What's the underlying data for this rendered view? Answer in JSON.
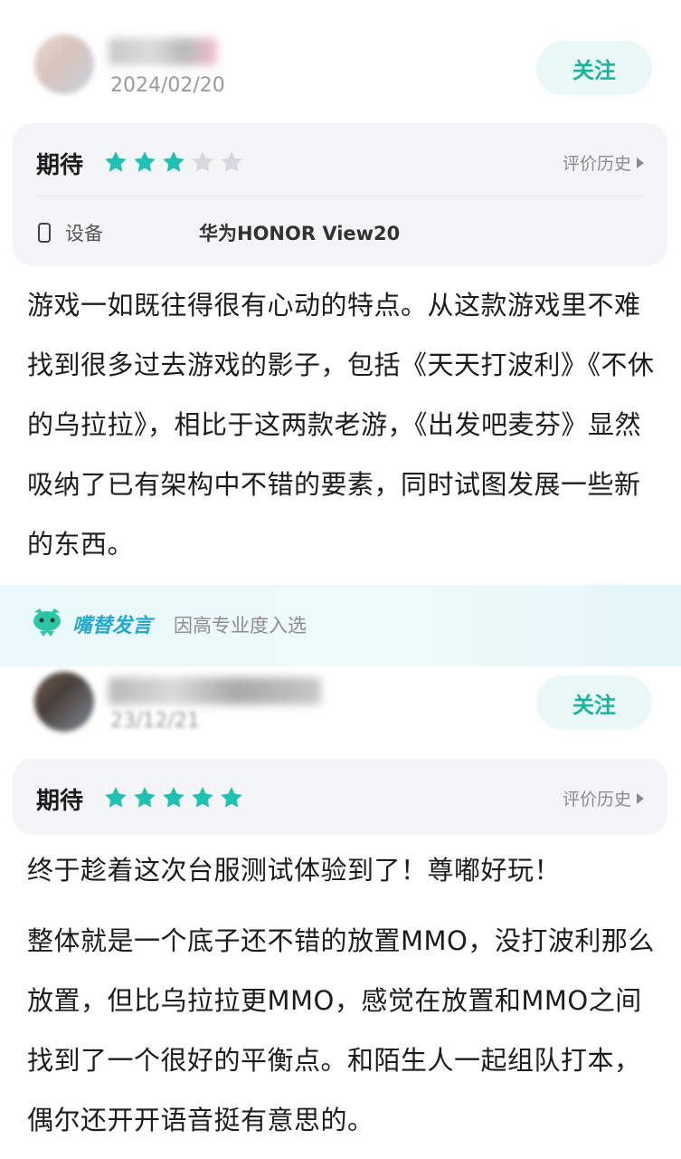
{
  "reviews": [
    {
      "date": "2024/02/20",
      "follow_label": "关注",
      "rating_label": "期待",
      "stars_filled": 3,
      "stars_total": 5,
      "history_label": "评价历史",
      "device_label": "设备",
      "device_value": "华为HONOR View20",
      "paragraphs": [
        "游戏一如既往得很有心动的特点。从这款游戏里不难找到很多过去游戏的影子，包括《天天打波利》《不休的乌拉拉》，相比于这两款老游，《出发吧麦芬》显然吸纳了已有架构中不错的要素，同时试图发展一些新的东西。"
      ]
    },
    {
      "date": "23/12/21",
      "follow_label": "关注",
      "rating_label": "期待",
      "stars_filled": 5,
      "stars_total": 5,
      "history_label": "评价历史",
      "paragraphs": [
        "终于趁着这次台服测试体验到了！尊嘟好玩！",
        "整体就是一个底子还不错的放置MMO，没打波利那么放置，但比乌拉拉更MMO，感觉在放置和MMO之间找到了一个很好的平衡点。和陌生人一起组队打本，偶尔还开开语音挺有意思的。"
      ]
    }
  ],
  "banner": {
    "title": "嘴替发言",
    "subtitle": "因高专业度入选",
    "icon": "mascot-icon"
  },
  "colors": {
    "accent": "#17b59e",
    "star_filled": "#1fc1b3",
    "star_empty": "#d6d9de",
    "follow_bg": "#e9f8f6",
    "card_bg": "#f4f5f7",
    "banner_title": "#22a9ce"
  }
}
